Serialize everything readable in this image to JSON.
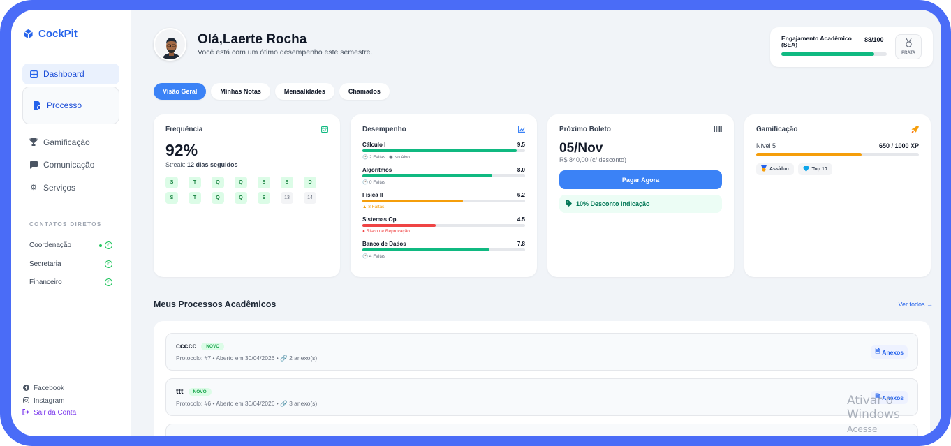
{
  "app": {
    "name": "CockPit"
  },
  "sidebar": {
    "items": [
      {
        "label": "Dashboard",
        "icon": "grid-icon",
        "active": true
      },
      {
        "label": "Processo",
        "icon": "file-icon"
      },
      {
        "label": "Gamificação",
        "icon": "trophy-icon"
      },
      {
        "label": "Comunicação",
        "icon": "chat-icon"
      },
      {
        "label": "Serviços",
        "icon": "gear-icon"
      }
    ],
    "contacts_title": "CONTATOS DIRETOS",
    "contacts": [
      {
        "label": "Coordenação",
        "online": true
      },
      {
        "label": "Secretaria"
      },
      {
        "label": "Financeiro"
      }
    ],
    "footer": {
      "facebook": "Facebook",
      "instagram": "Instagram",
      "logout": "Sair da Conta"
    }
  },
  "header": {
    "greeting": "Olá,Laerte Rocha",
    "subtitle": "Você está com um ótimo desempenho este semestre."
  },
  "sea": {
    "label": "Engajamento Acadêmico (SEA)",
    "value_text": "88/100",
    "progress": 0.88,
    "medal": "PRATA"
  },
  "tabs": [
    "Visão Geral",
    "Minhas Notas",
    "Mensalidades",
    "Chamados"
  ],
  "frequencia": {
    "title": "Frequência",
    "value": "92%",
    "streak_label": "Streak:",
    "streak_value": "12 dias seguidos",
    "days": [
      {
        "t": "S",
        "ok": true
      },
      {
        "t": "T",
        "ok": true
      },
      {
        "t": "Q",
        "ok": true
      },
      {
        "t": "Q",
        "ok": true
      },
      {
        "t": "S",
        "ok": true
      },
      {
        "t": "S",
        "ok": true
      },
      {
        "t": "D",
        "ok": true
      },
      {
        "t": "S",
        "ok": true
      },
      {
        "t": "T",
        "ok": true
      },
      {
        "t": "Q",
        "ok": true
      },
      {
        "t": "Q",
        "ok": true
      },
      {
        "t": "S",
        "ok": true
      },
      {
        "t": "13",
        "ok": false
      },
      {
        "t": "14",
        "ok": false
      }
    ]
  },
  "desempenho": {
    "title": "Desempenho",
    "subjects": [
      {
        "name": "Cálculo I",
        "grade": "9.5",
        "progress": 0.95,
        "color": "#10b981",
        "notes": [
          {
            "icon": "clock-icon",
            "text": "2 Faltas"
          },
          {
            "icon": "check-icon",
            "text": "No Alvo"
          }
        ]
      },
      {
        "name": "Algoritmos",
        "grade": "8.0",
        "progress": 0.8,
        "color": "#10b981",
        "notes": [
          {
            "icon": "clock-icon",
            "text": "0 Faltas"
          }
        ]
      },
      {
        "name": "Física II",
        "grade": "6.2",
        "progress": 0.62,
        "color": "#f59e0b",
        "notes": [
          {
            "icon": "warning-icon",
            "text": "8 Faltas",
            "kind": "warn"
          }
        ]
      },
      {
        "name": "Sistemas Op.",
        "grade": "4.5",
        "progress": 0.45,
        "color": "#ef4444",
        "notes": [
          {
            "icon": "alert-icon",
            "text": "Risco de Reprovação",
            "kind": "risk"
          }
        ]
      },
      {
        "name": "Banco de Dados",
        "grade": "7.8",
        "progress": 0.78,
        "color": "#10b981",
        "notes": [
          {
            "icon": "clock-icon",
            "text": "4 Faltas"
          }
        ]
      }
    ]
  },
  "boleto": {
    "title": "Próximo Boleto",
    "date": "05/Nov",
    "amount": "R$ 840,00 (c/ desconto)",
    "pay_label": "Pagar Agora",
    "discount": "10% Desconto Indicação"
  },
  "gamificacao": {
    "title": "Gamificação",
    "level": "Nível 5",
    "xp": "650 / 1000 XP",
    "progress": 0.65,
    "badges": [
      {
        "icon": "medal-icon",
        "label": "Assíduo"
      },
      {
        "icon": "diamond-icon",
        "label": "Top 10"
      }
    ]
  },
  "processos": {
    "title": "Meus Processos Acadêmicos",
    "see_all": "Ver todos →",
    "items": [
      {
        "name": "ccccc",
        "tag": "NOVO",
        "meta": "Protocolo: #7 • Aberto em 30/04/2026 • 🔗 2 anexo(s)",
        "action": "Anexos"
      },
      {
        "name": "ttt",
        "tag": "NOVO",
        "meta": "Protocolo: #6 • Aberto em 30/04/2026 • 🔗 3 anexo(s)",
        "action": "Anexos"
      }
    ]
  },
  "watermark": {
    "line1": "Ativar o Windows",
    "line2": "Acesse Configurações para ativar o Windows."
  }
}
